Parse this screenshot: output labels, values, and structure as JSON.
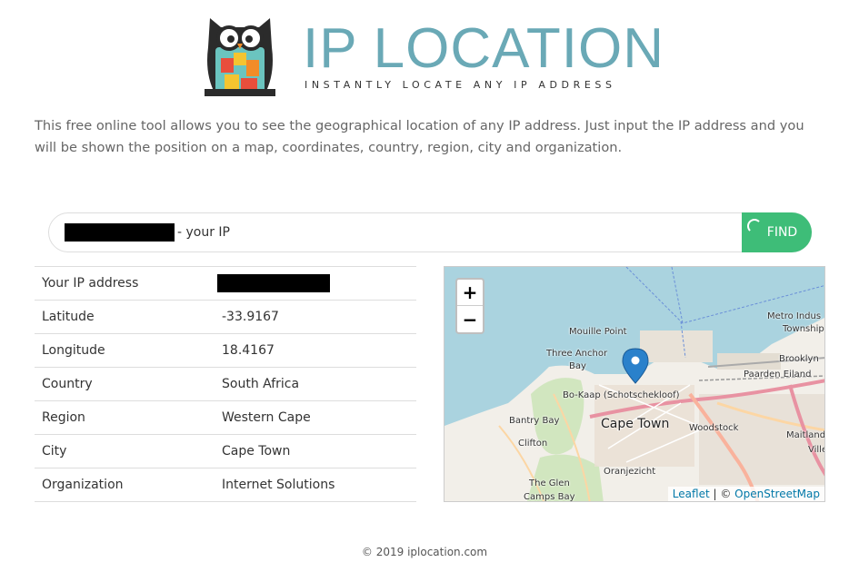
{
  "header": {
    "title": "IP LOCATION",
    "tagline": "INSTANTLY LOCATE ANY IP ADDRESS"
  },
  "intro": "This free online tool allows you to see the geographical location of any IP address. Just input the IP address and you will be shown the position on a map, coordinates, country, region, city and organization.",
  "search": {
    "suffix": "- your IP",
    "button_label": "FIND"
  },
  "info": {
    "rows": [
      {
        "label": "Your IP address",
        "value": ""
      },
      {
        "label": "Latitude",
        "value": "-33.9167"
      },
      {
        "label": "Longitude",
        "value": "18.4167"
      },
      {
        "label": "Country",
        "value": "South Africa"
      },
      {
        "label": "Region",
        "value": "Western Cape"
      },
      {
        "label": "City",
        "value": "Cape Town"
      },
      {
        "label": "Organization",
        "value": "Internet Solutions"
      }
    ]
  },
  "map": {
    "labels": {
      "mouille_point": "Mouille Point",
      "three_anchor": "Three Anchor",
      "bay": "Bay",
      "bo_kaap": "Bo-Kaap (Schotschekloof)",
      "bantry_bay": "Bantry Bay",
      "cape_town": "Cape Town",
      "woodstock": "Woodstock",
      "clifton": "Clifton",
      "oranjezicht": "Oranjezicht",
      "the_glen": "The Glen",
      "camps_bay": "Camps Bay",
      "metro_indus": "Metro Indus",
      "township": "Township",
      "brooklyn": "Brooklyn",
      "paarden_eiland": "Paarden Eiland",
      "maitland": "Maitland",
      "ville": "Ville"
    },
    "zoom_in": "+",
    "zoom_out": "−",
    "attribution": {
      "leaflet": "Leaflet",
      "separator": " | © ",
      "osm": "OpenStreetMap"
    },
    "colors": {
      "water": "#aad3df",
      "land": "#f2efe9",
      "park": "#c8e3b4",
      "marker": "#2a81cb"
    }
  },
  "footer": "© 2019 iplocation.com"
}
